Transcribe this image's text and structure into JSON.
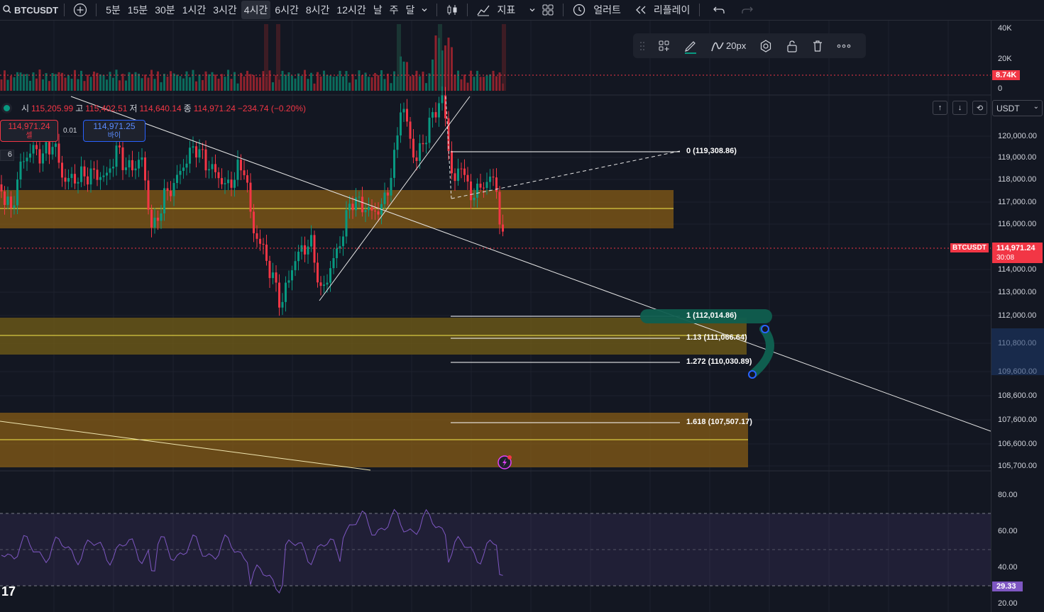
{
  "toolbar": {
    "symbol": "BTCUSDT",
    "timeframes": [
      "5분",
      "15분",
      "30분",
      "1시간",
      "3시간",
      "4시간",
      "6시간",
      "8시간",
      "12시간",
      "날",
      "주",
      "달"
    ],
    "active_timeframe_index": 5,
    "indicators_label": "지표",
    "alert_label": "얼러트",
    "replay_label": "리플레이"
  },
  "ohlc": {
    "open_label": "시",
    "open": "115,205.99",
    "high_label": "고",
    "high": "115,402.51",
    "low_label": "저",
    "low": "114,640.14",
    "close_label": "종",
    "close": "114,971.24",
    "change": "−234.74 (−0.20%)"
  },
  "trade": {
    "sell_price": "114,971.24",
    "sell_label": "셀",
    "quantity": "0.01",
    "buy_price": "114,971.25",
    "buy_label": "바이"
  },
  "indicator_count": "6",
  "drawing_toolbar": {
    "width_label": "20px"
  },
  "currency_selector": "USDT",
  "volume_axis": [
    "40K",
    "20K",
    "0"
  ],
  "volume_tag": "8.74K",
  "price_axis": [
    "120,000.00",
    "119,000.00",
    "118,000.00",
    "117,000.00",
    "116,000.00",
    "114,000.00",
    "113,000.00",
    "112,000.00",
    "110,800.00",
    "109,600.00",
    "108,600.00",
    "107,600.00",
    "106,600.00",
    "105,700.00"
  ],
  "current_price": {
    "symbol_tag": "BTCUSDT",
    "price": "114,971.24",
    "countdown": "30:08"
  },
  "fib_levels": [
    {
      "label": "0 (119,308.86)",
      "price": 119308.86
    },
    {
      "label": "1 (112,014.86)",
      "price": 112014.86
    },
    {
      "label": "1.13 (111,066.64)",
      "price": 111066.64
    },
    {
      "label": "1.272 (110,030.89)",
      "price": 110030.89
    },
    {
      "label": "1.618 (107,507.17)",
      "price": 107507.17
    }
  ],
  "rsi_axis": [
    "80.00",
    "60.00",
    "40.00",
    "20.00"
  ],
  "rsi_value": "29.33",
  "colors": {
    "up": "#089981",
    "down": "#f23645",
    "zone": "#8b5e15",
    "rsi": "#7e57c2",
    "background": "#131722"
  },
  "icons": [
    "plus-circle-icon",
    "chevron-down-icon",
    "candles-icon",
    "indicators-icon",
    "layout-icon",
    "alert-clock-icon",
    "replay-icon",
    "undo-icon",
    "redo-icon",
    "drag-icon",
    "template-icon",
    "pencil-icon",
    "line-width-icon",
    "settings-icon",
    "lock-icon",
    "trash-icon",
    "more-icon",
    "arrow-up-icon",
    "arrow-down-icon",
    "reset-icon",
    "lightning-icon",
    "tradingview-logo"
  ]
}
